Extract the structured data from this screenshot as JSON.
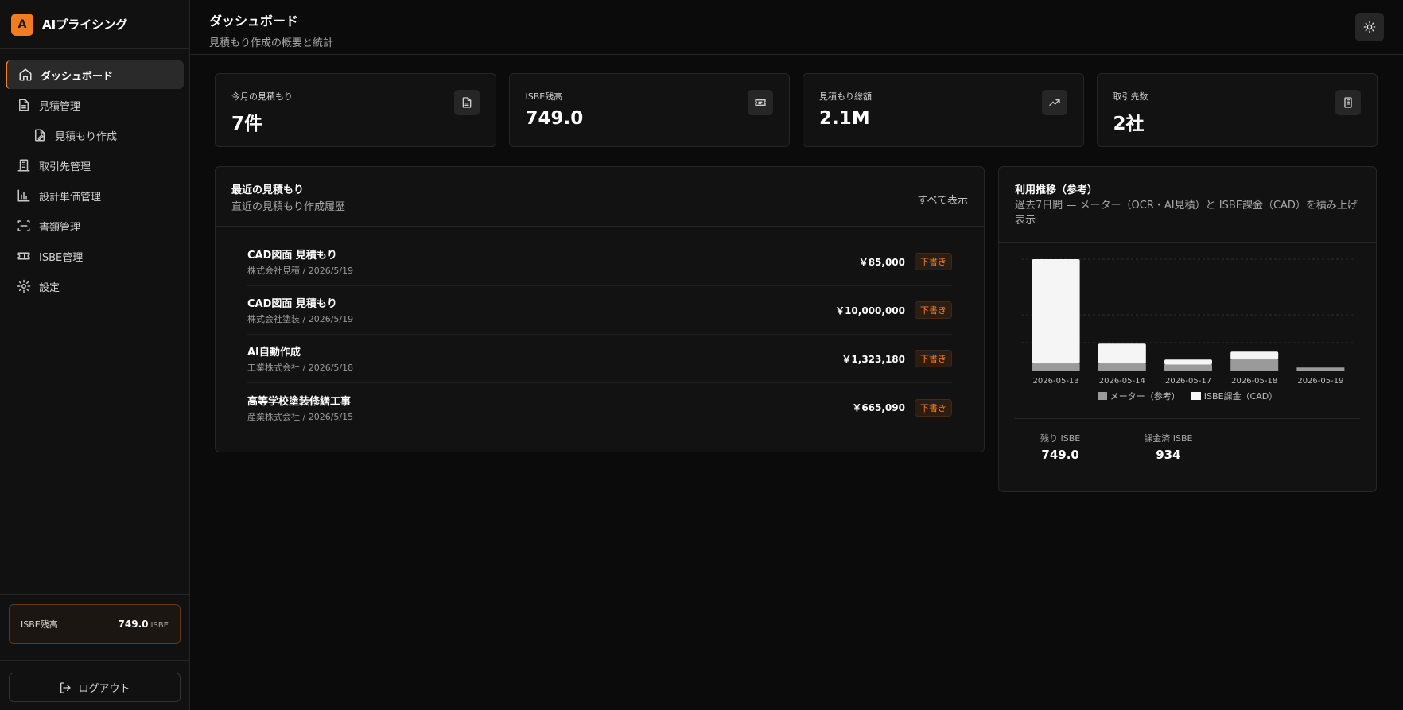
{
  "brand": {
    "logo_letter": "A",
    "name": "AIプライシング"
  },
  "sidebar": {
    "items": [
      {
        "label": "ダッシュボード",
        "icon": "home-icon",
        "active": true
      },
      {
        "label": "見積管理",
        "icon": "document-icon"
      },
      {
        "label": "見積もり作成",
        "icon": "document-edit-icon",
        "sub": true
      },
      {
        "label": "取引先管理",
        "icon": "building-icon"
      },
      {
        "label": "設計単価管理",
        "icon": "bar-chart-icon"
      },
      {
        "label": "書類管理",
        "icon": "scan-icon"
      },
      {
        "label": "ISBE管理",
        "icon": "ticket-icon"
      },
      {
        "label": "設定",
        "icon": "gear-icon"
      }
    ],
    "isbe_label": "ISBE残高",
    "isbe_value": "749.0",
    "isbe_unit": "ISBE",
    "logout_label": "ログアウト"
  },
  "header": {
    "title": "ダッシュボード",
    "subtitle": "見積もり作成の概要と統計"
  },
  "stats": [
    {
      "label": "今月の見積もり",
      "value": "7件",
      "icon": "document-icon"
    },
    {
      "label": "ISBE残高",
      "value": "749.0",
      "icon": "ticket-icon"
    },
    {
      "label": "見積もり総額",
      "value": "2.1M",
      "icon": "trend-up-icon"
    },
    {
      "label": "取引先数",
      "value": "2社",
      "icon": "building-icon"
    }
  ],
  "recent": {
    "title": "最近の見積もり",
    "subtitle": "直近の見積もり作成履歴",
    "view_all": "すべて表示",
    "items": [
      {
        "name": "CAD図面 見積もり",
        "meta": "株式会社見積 / 2026/5/19",
        "amount": "￥85,000",
        "status": "下書き"
      },
      {
        "name": "CAD図面 見積もり",
        "meta": "株式会社塗装 / 2026/5/19",
        "amount": "￥10,000,000",
        "status": "下書き"
      },
      {
        "name": "AI自動作成",
        "meta": "工業株式会社 / 2026/5/18",
        "amount": "￥1,323,180",
        "status": "下書き"
      },
      {
        "name": "高等学校塗装修繕工事",
        "meta": "産業株式会社 / 2026/5/15",
        "amount": "￥665,090",
        "status": "下書き"
      }
    ]
  },
  "usage": {
    "title": "利用推移（参考）",
    "subtitle": "過去7日間 — メーター（OCR・AI見積）と ISBE課金（CAD）を積み上げ表示",
    "remaining_label": "残り ISBE",
    "remaining_value": "749.0",
    "charged_label": "課金済 ISBE",
    "charged_value": "934"
  },
  "chart_data": {
    "type": "bar",
    "stacked": true,
    "categories": [
      "2026-05-13",
      "2026-05-14",
      "2026-05-17",
      "2026-05-18",
      "2026-05-19"
    ],
    "series": [
      {
        "name": "メーター（参考）",
        "color": "#9a9a9a",
        "values": [
          7,
          7,
          6,
          11,
          3
        ]
      },
      {
        "name": "ISBE課金（CAD）",
        "color": "#f5f5f5",
        "values": [
          105,
          20,
          5,
          8,
          0
        ]
      }
    ],
    "ylim": [
      0,
      112
    ],
    "grid": true,
    "legend": "bottom"
  }
}
